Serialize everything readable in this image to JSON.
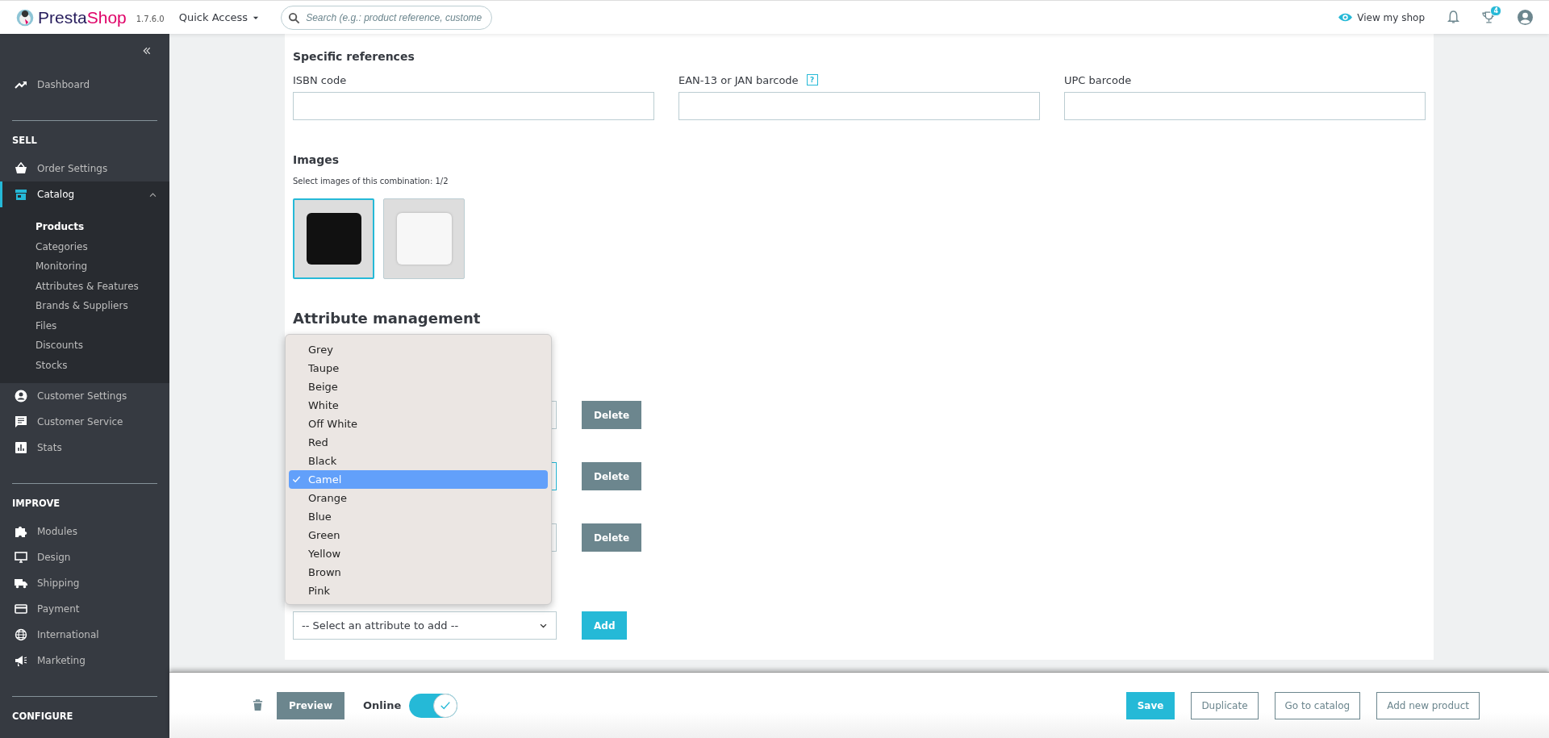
{
  "header": {
    "logo": [
      "Presta",
      "Shop"
    ],
    "version": "1.7.6.0",
    "quick_access": "Quick Access",
    "search": {
      "placeholder": "Search (e.g.: product reference, custome"
    },
    "view_shop": "View my shop",
    "badge": "4"
  },
  "sidebar": {
    "sections": [
      {
        "items": [
          {
            "kind": "trend",
            "label": "Dashboard",
            "selected": false
          }
        ]
      },
      {
        "heading": "SELL",
        "items": [
          {
            "kind": "basket",
            "label": "Order Settings",
            "selected": false
          },
          {
            "kind": "store",
            "label": "Catalog",
            "selected": true,
            "expanded": true,
            "children": [
              {
                "label": "Products",
                "selected": true
              },
              {
                "label": "Categories",
                "selected": false
              },
              {
                "label": "Monitoring",
                "selected": false
              },
              {
                "label": "Attributes & Features",
                "selected": false
              },
              {
                "label": "Brands & Suppliers",
                "selected": false
              },
              {
                "label": "Files",
                "selected": false
              },
              {
                "label": "Discounts",
                "selected": false
              },
              {
                "label": "Stocks",
                "selected": false
              }
            ]
          },
          {
            "kind": "user",
            "label": "Customer Settings",
            "selected": false
          },
          {
            "kind": "chat",
            "label": "Customer Service",
            "selected": false
          },
          {
            "kind": "stats",
            "label": "Stats",
            "selected": false
          }
        ]
      },
      {
        "heading": "IMPROVE",
        "items": [
          {
            "kind": "puzzle",
            "label": "Modules",
            "selected": false
          },
          {
            "kind": "monitor",
            "label": "Design",
            "selected": false
          },
          {
            "kind": "truck",
            "label": "Shipping",
            "selected": false
          },
          {
            "kind": "card",
            "label": "Payment",
            "selected": false
          },
          {
            "kind": "globe",
            "label": "International",
            "selected": false
          },
          {
            "kind": "megaphone",
            "label": "Marketing",
            "selected": false
          }
        ]
      },
      {
        "heading": "CONFIGURE"
      }
    ]
  },
  "specific_references": {
    "title": "Specific references",
    "fields": [
      {
        "label": "ISBN code"
      },
      {
        "label": "EAN-13 or JAN barcode",
        "help": "?"
      },
      {
        "label": "UPC barcode"
      }
    ]
  },
  "images": {
    "title": "Images",
    "caption": "Select images of this combination: 1/2",
    "items": [
      {
        "kind": "dark",
        "selected": true
      },
      {
        "kind": "light",
        "selected": false
      }
    ]
  },
  "attributes": {
    "title": "Attribute management",
    "rows": [
      {
        "focused": false,
        "button": "Delete"
      },
      {
        "focused": true,
        "button": "Delete"
      },
      {
        "focused": false,
        "button": "Delete"
      }
    ],
    "add_select": {
      "value": "-- Select an attribute to add --"
    },
    "add_button": "Add",
    "dropdown": {
      "options": [
        {
          "label": "Grey",
          "selected": false
        },
        {
          "label": "Taupe",
          "selected": false
        },
        {
          "label": "Beige",
          "selected": false
        },
        {
          "label": "White",
          "selected": false
        },
        {
          "label": "Off White",
          "selected": false
        },
        {
          "label": "Red",
          "selected": false
        },
        {
          "label": "Black",
          "selected": false
        },
        {
          "label": "Camel",
          "selected": true
        },
        {
          "label": "Orange",
          "selected": false
        },
        {
          "label": "Blue",
          "selected": false
        },
        {
          "label": "Green",
          "selected": false
        },
        {
          "label": "Yellow",
          "selected": false
        },
        {
          "label": "Brown",
          "selected": false
        },
        {
          "label": "Pink",
          "selected": false
        }
      ]
    }
  },
  "footer": {
    "preview": "Preview",
    "online_label": "Online",
    "online": true,
    "buttons": [
      {
        "kind": "primary",
        "label": "Save"
      },
      {
        "kind": "outline",
        "label": "Duplicate"
      },
      {
        "kind": "outline",
        "label": "Go to catalog"
      },
      {
        "kind": "outline",
        "label": "Add new product"
      }
    ]
  }
}
